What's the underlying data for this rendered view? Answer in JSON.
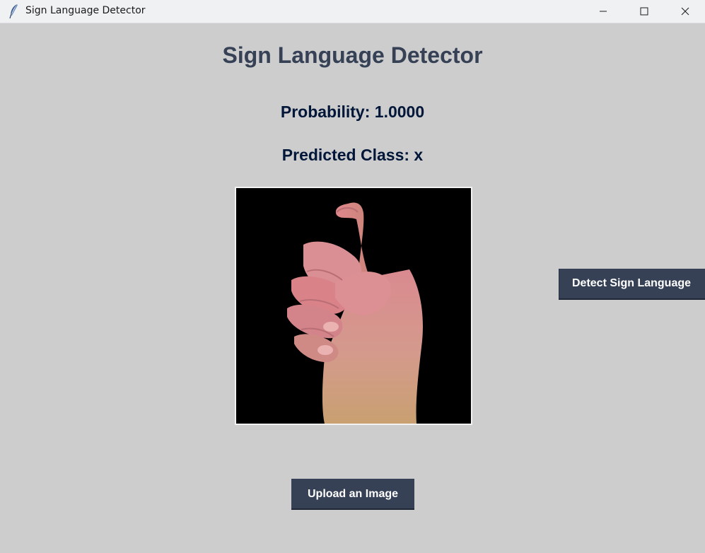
{
  "window": {
    "title": "Sign Language Detector",
    "icon": "feather-icon",
    "controls": [
      "minimize-icon",
      "maximize-icon",
      "close-icon"
    ]
  },
  "main": {
    "heading": "Sign Language Detector",
    "probability_text": "Probability: 1.0000",
    "predicted_class_text": "Predicted Class: x",
    "uploaded_image": "hand-sign-photo",
    "detect_button_label": "Detect Sign Language",
    "upload_button_label": "Upload an Image"
  },
  "colors": {
    "background": "#cdcdcd",
    "heading": "#364156",
    "result_text": "#011638",
    "button_bg": "#364156",
    "button_text": "#ffffff",
    "titlebar": "#f0f1f3"
  }
}
